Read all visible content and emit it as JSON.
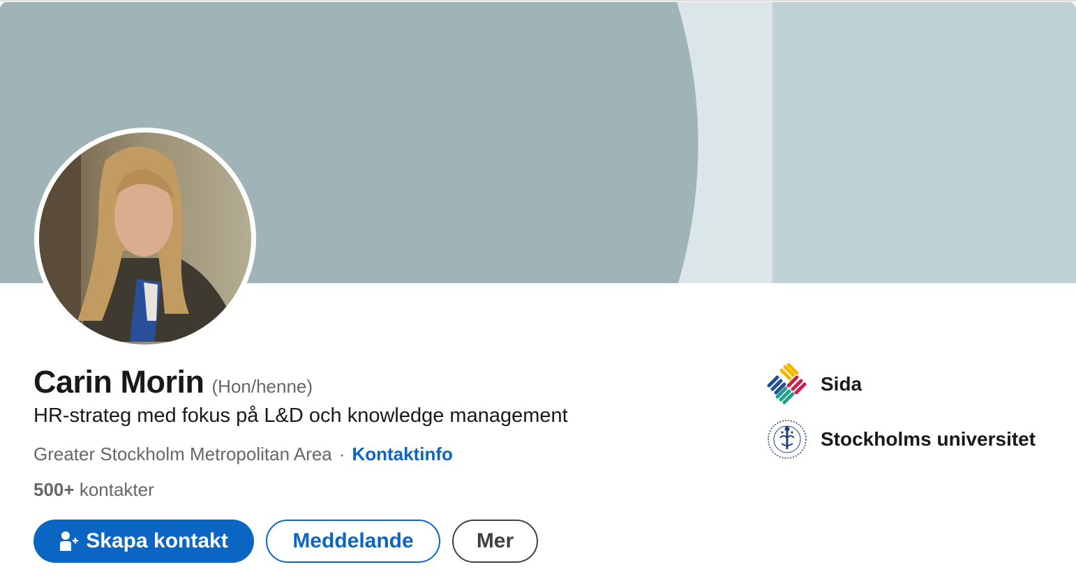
{
  "profile": {
    "name": "Carin Morin",
    "pronouns": "(Hon/henne)",
    "headline": "HR-strateg med fokus på L&D och knowledge management",
    "location": "Greater Stockholm Metropolitan Area",
    "separator": "·",
    "contact_info_link": "Kontaktinfo",
    "connections_count": "500+",
    "connections_label": "kontakter"
  },
  "actions": {
    "primary_label": "Skapa kontakt",
    "primary_icon": "add-person-icon",
    "message_label": "Meddelande",
    "more_label": "Mer"
  },
  "organizations": [
    {
      "name": "Sida",
      "logo": "sida-logo"
    },
    {
      "name": "Stockholms universitet",
      "logo": "stockholms-universitet-seal"
    }
  ],
  "colors": {
    "accent": "#0a66c2",
    "banner_main": "#a0b3b7",
    "banner_light": "#dbe6e9",
    "banner_right": "#bed1d5",
    "text_primary": "#191919",
    "text_secondary": "#666666"
  }
}
